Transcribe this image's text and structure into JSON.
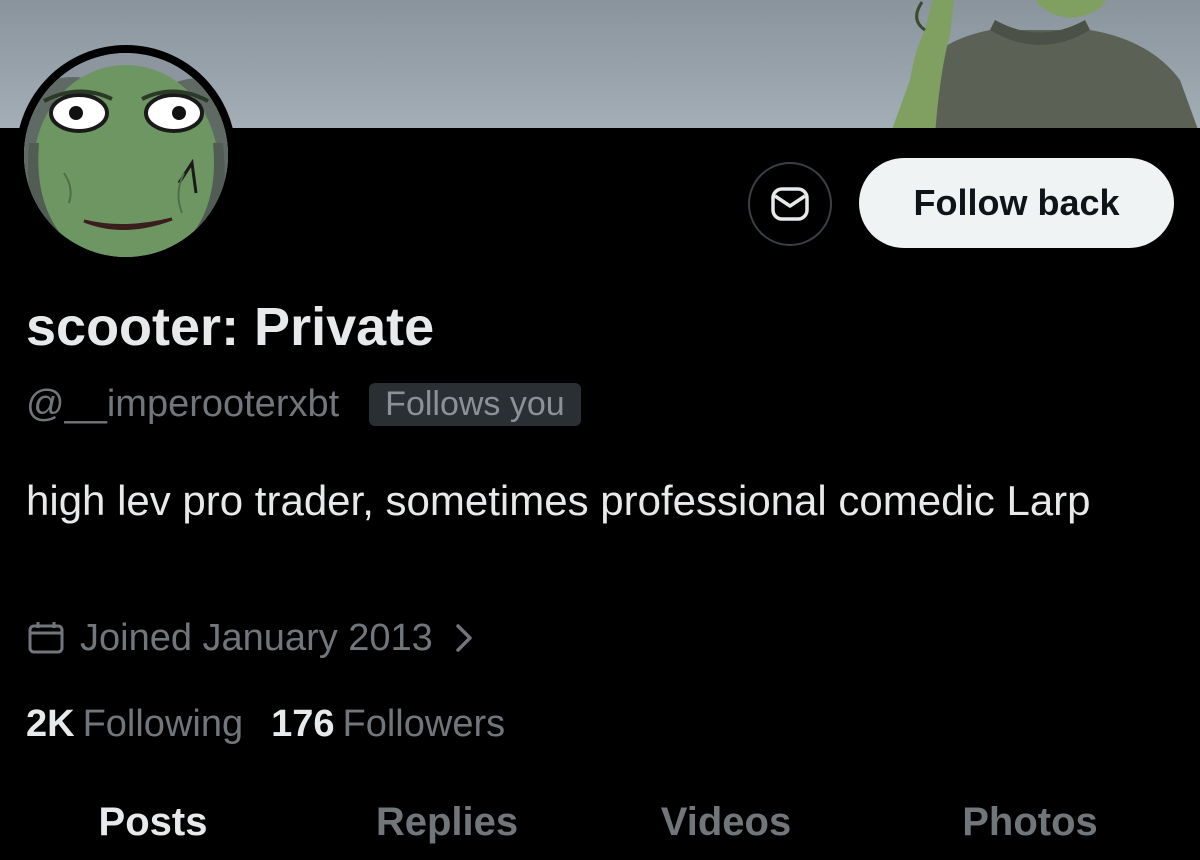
{
  "profile": {
    "display_name": "scooter: Private",
    "handle": "@__imperooterxbt",
    "follows_badge": "Follows you",
    "bio": "high lev pro trader, sometimes professional comedic Larp",
    "joined": "Joined January 2013"
  },
  "actions": {
    "message_icon": "message-icon",
    "follow_back_label": "Follow back"
  },
  "stats": {
    "following_count": "2K",
    "following_label": "Following",
    "followers_count": "176",
    "followers_label": "Followers"
  },
  "tabs": [
    {
      "label": "Posts",
      "active": true
    },
    {
      "label": "Replies",
      "active": false
    },
    {
      "label": "Videos",
      "active": false
    },
    {
      "label": "Photos",
      "active": false
    }
  ],
  "colors": {
    "background": "#000000",
    "primary_text": "#e7e9ea",
    "secondary_text": "#71767b",
    "follow_button_bg": "#eff3f4",
    "badge_bg": "#2a2f33"
  }
}
